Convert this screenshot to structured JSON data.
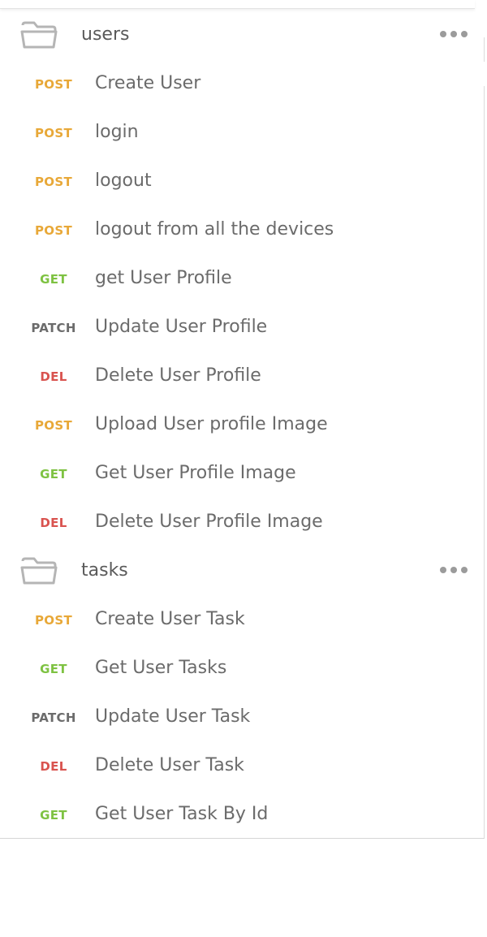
{
  "colors": {
    "POST": "#e8a838",
    "GET": "#7ec242",
    "PATCH": "#6b6b6b",
    "DEL": "#d9534f"
  },
  "icons": {
    "folder": "folder-icon",
    "more": "more-options-icon"
  },
  "folders": [
    {
      "name": "users",
      "requests": [
        {
          "method": "POST",
          "name": "Create User"
        },
        {
          "method": "POST",
          "name": "login"
        },
        {
          "method": "POST",
          "name": "logout"
        },
        {
          "method": "POST",
          "name": "logout from all the devices"
        },
        {
          "method": "GET",
          "name": "get User Profile"
        },
        {
          "method": "PATCH",
          "name": "Update User Profile"
        },
        {
          "method": "DEL",
          "name": "Delete User Profile"
        },
        {
          "method": "POST",
          "name": "Upload User profile Image"
        },
        {
          "method": "GET",
          "name": "Get User Profile Image"
        },
        {
          "method": "DEL",
          "name": "Delete User Profile Image"
        }
      ]
    },
    {
      "name": "tasks",
      "requests": [
        {
          "method": "POST",
          "name": "Create User Task"
        },
        {
          "method": "GET",
          "name": "Get User Tasks"
        },
        {
          "method": "PATCH",
          "name": "Update User Task"
        },
        {
          "method": "DEL",
          "name": "Delete User Task"
        },
        {
          "method": "GET",
          "name": "Get User Task By Id"
        }
      ]
    }
  ]
}
